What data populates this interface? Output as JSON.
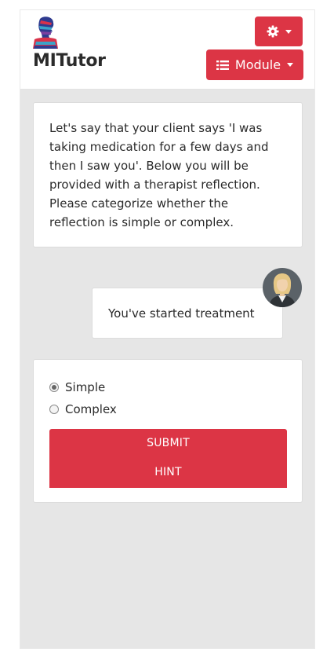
{
  "header": {
    "brand": "MITutor",
    "settings_icon": "gear-icon",
    "module_icon": "list-icon",
    "module_label": "Module"
  },
  "prompt": {
    "text": "Let's say that your client says 'I was taking medication for a few days and then I saw you'. Below you will be provided with a therapist reflection. Please categorize whether the reflection is simple or complex."
  },
  "reflection": {
    "avatar_icon": "therapist-avatar-icon",
    "text": "You've started treatment"
  },
  "answer": {
    "options": [
      {
        "label": "Simple",
        "selected": true
      },
      {
        "label": "Complex",
        "selected": false
      }
    ],
    "submit_label": "SUBMIT",
    "hint_label": "HINT"
  },
  "colors": {
    "accent": "#dc3545",
    "background": "#e6e6e6",
    "card": "#ffffff"
  }
}
